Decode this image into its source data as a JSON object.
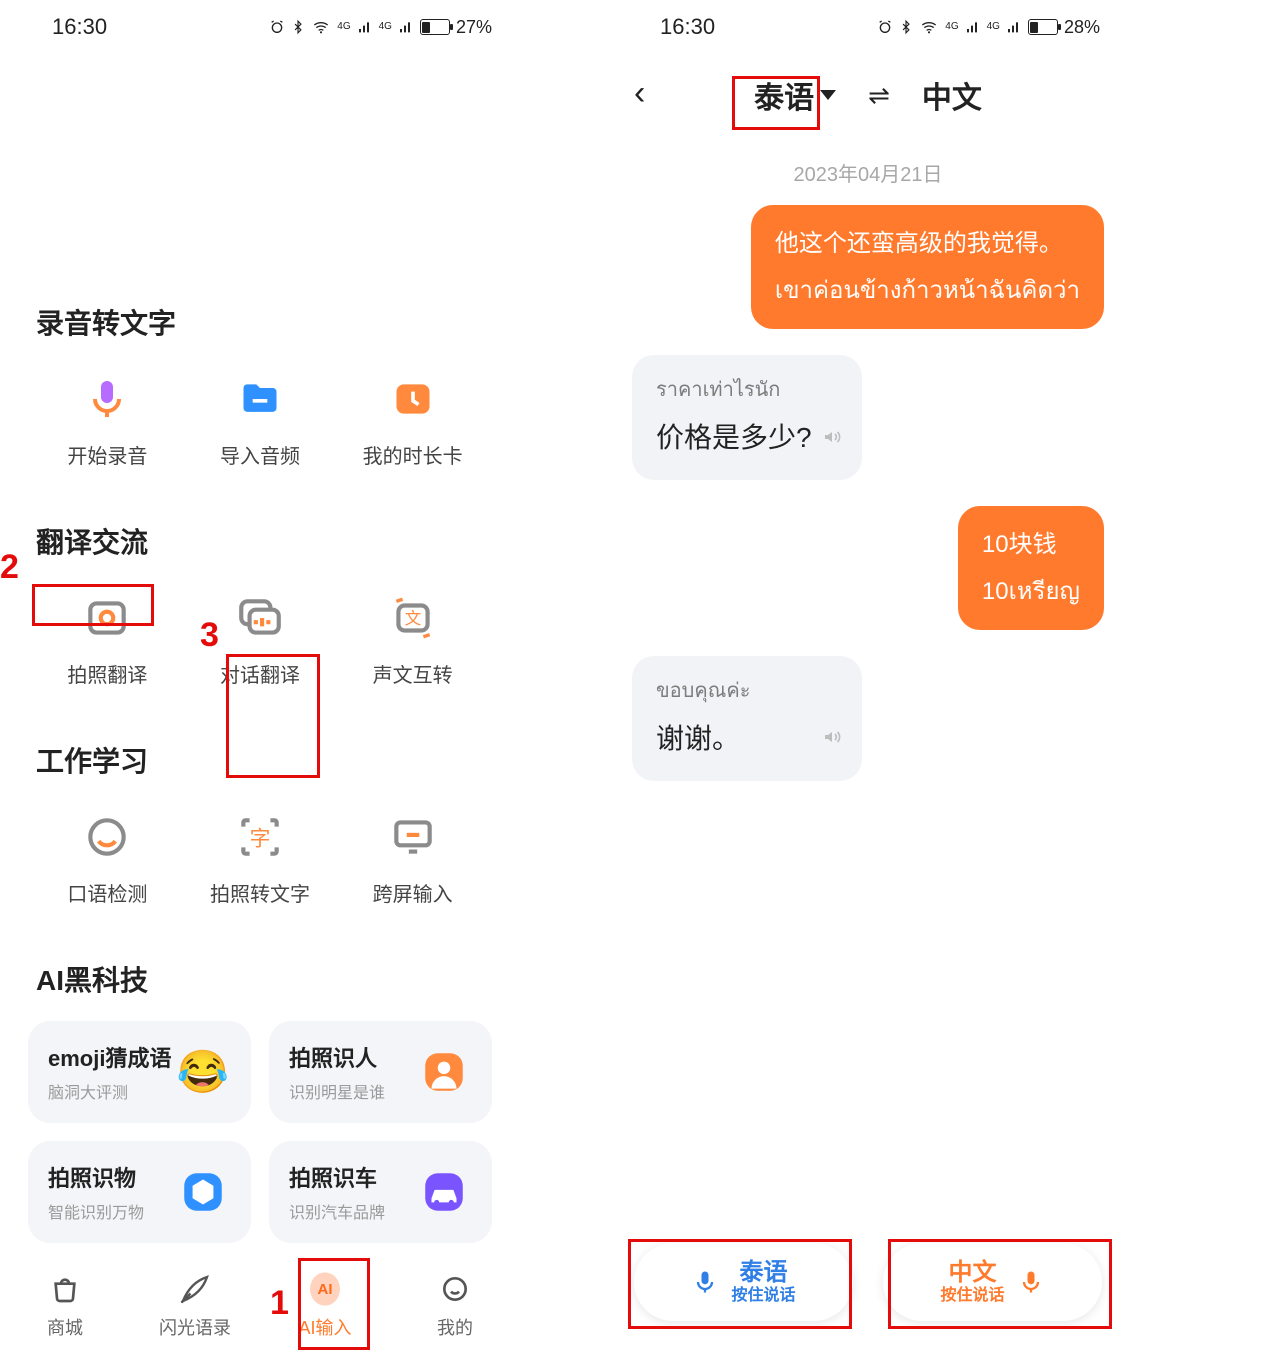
{
  "left_status": {
    "time": "16:30",
    "battery_pct": "27%"
  },
  "right_status": {
    "time": "16:30",
    "battery_pct": "28%"
  },
  "sections": {
    "audio": {
      "title": "录音转文字",
      "items": [
        {
          "label": "开始录音"
        },
        {
          "label": "导入音频"
        },
        {
          "label": "我的时长卡"
        }
      ]
    },
    "translate": {
      "title": "翻译交流",
      "items": [
        {
          "label": "拍照翻译"
        },
        {
          "label": "对话翻译"
        },
        {
          "label": "声文互转"
        }
      ]
    },
    "work": {
      "title": "工作学习",
      "items": [
        {
          "label": "口语检测"
        },
        {
          "label": "拍照转文字"
        },
        {
          "label": "跨屏输入"
        }
      ]
    },
    "ai": {
      "title": "AI黑科技",
      "cards": [
        {
          "title": "emoji猜成语",
          "subtitle": "脑洞大评测"
        },
        {
          "title": "拍照识人",
          "subtitle": "识别明星是谁"
        },
        {
          "title": "拍照识物",
          "subtitle": "智能识别万物"
        },
        {
          "title": "拍照识车",
          "subtitle": "识别汽车品牌"
        }
      ]
    }
  },
  "bottom_nav": [
    {
      "label": "商城"
    },
    {
      "label": "闪光语录"
    },
    {
      "label": "AI输入"
    },
    {
      "label": "我的"
    }
  ],
  "annotations": {
    "n1": "1",
    "n2": "2",
    "n3": "3"
  },
  "right": {
    "lang_from": "泰语",
    "lang_to": "中文",
    "date": "2023年04月21日",
    "messages": [
      {
        "side": "me",
        "text": "他这个还蛮高级的我觉得。",
        "translation": "เขาค่อนข้างก้าวหน้าฉันคิดว่า"
      },
      {
        "side": "other",
        "text": "ราคาเท่าไรนัก",
        "translation": "价格是多少?"
      },
      {
        "side": "me",
        "text": "10块钱",
        "translation": "10เหรียญ"
      },
      {
        "side": "other",
        "text": "ขอบคุณค่ะ",
        "translation": "谢谢。"
      }
    ],
    "voice": {
      "left": {
        "lang": "泰语",
        "hint": "按住说话",
        "color": "#2f7fe6"
      },
      "right": {
        "lang": "中文",
        "hint": "按住说话",
        "color": "#ff7a2c"
      }
    }
  }
}
